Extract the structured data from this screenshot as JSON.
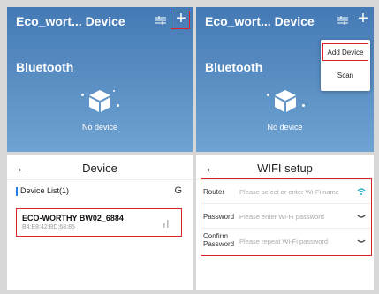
{
  "panel1": {
    "title": "Eco_wort... Device",
    "section": "Bluetooth",
    "empty_text": "No device"
  },
  "panel2": {
    "title": "Eco_wort... Device",
    "section": "Bluetooth",
    "empty_text": "No device",
    "menu": [
      "Add Device",
      "Scan"
    ]
  },
  "panel3": {
    "back": "←",
    "title": "Device",
    "list_header": "Device List(1)",
    "refresh": "G",
    "device": {
      "name": "ECO-WORTHY BW02_6884",
      "mac": "B4:E8:42:BD:68:85"
    }
  },
  "panel4": {
    "back": "←",
    "title": "WIFI setup",
    "rows": [
      {
        "label": "Router",
        "placeholder": "Please select or enter Wi-Fi name"
      },
      {
        "label": "Password",
        "placeholder": "Please enter Wi-Fi password"
      },
      {
        "label": "Confirm Password",
        "placeholder": "Please repeat Wi-Fi password"
      }
    ]
  },
  "colors": {
    "header_blue": "#4579b4",
    "highlight_red": "#d9222a",
    "accent_blue": "#2a7be4",
    "wifi_teal": "#1aa6c9"
  },
  "icons": [
    "tune-icon",
    "plus-icon",
    "cube-icon",
    "refresh-icon",
    "signal-icon",
    "wifi-icon",
    "eye-closed-icon"
  ]
}
